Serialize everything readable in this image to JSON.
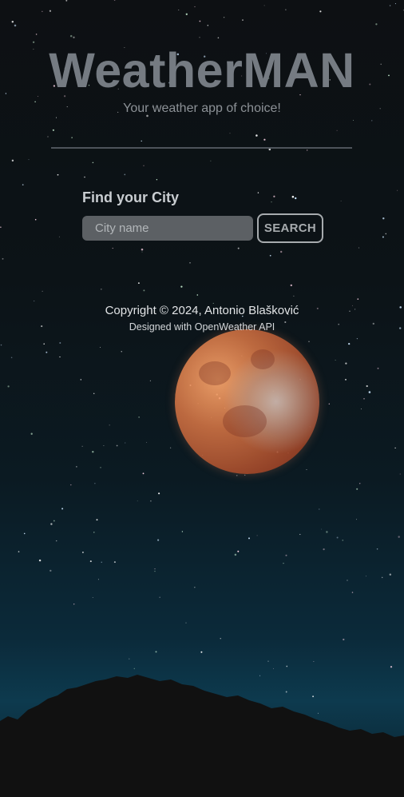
{
  "header": {
    "title": "WeatherMAN",
    "subtitle": "Your weather app of choice!"
  },
  "search": {
    "label": "Find your City",
    "placeholder": "City name",
    "value": "",
    "button_label": "SEARCH"
  },
  "footer": {
    "copyright": "Copyright © 2024, Antonio Blašković",
    "credit": "Designed with OpenWeather API"
  },
  "colors": {
    "title": "#757b82",
    "input_bg": "#5c6064",
    "button_border": "#a7abae"
  },
  "background": {
    "scene": "night-sky-with-red-moon-icon"
  }
}
